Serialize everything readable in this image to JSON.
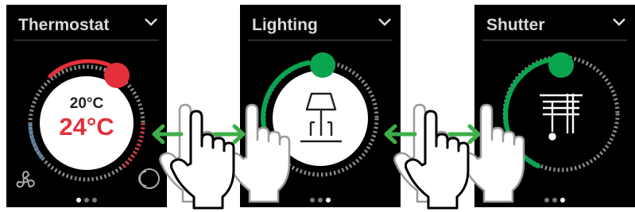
{
  "panels": [
    {
      "title": "Thermostat",
      "icon": "thermostat-dial",
      "setpoint": "20°C",
      "current": "24°C",
      "accent": "#e4303a",
      "page_indicator": {
        "count": 3,
        "active": 1
      },
      "aux_icons": [
        "fan-icon",
        "power-knob-icon"
      ]
    },
    {
      "title": "Lighting",
      "icon": "lamp-icon",
      "accent": "#0aa54f",
      "page_indicator": {
        "count": 3,
        "active": 3
      }
    },
    {
      "title": "Shutter",
      "icon": "shutter-icon",
      "accent": "#0aa54f",
      "page_indicator": {
        "count": 3,
        "active": 3
      }
    }
  ],
  "gestures": [
    {
      "name": "swipe-left-right",
      "arrow_color": "#3fae49"
    },
    {
      "name": "swipe-left-right",
      "arrow_color": "#3fae49"
    }
  ],
  "colors": {
    "heat": "#e4303a",
    "cool": "#4a8fd0",
    "on": "#0aa54f",
    "panel": "#000000"
  }
}
